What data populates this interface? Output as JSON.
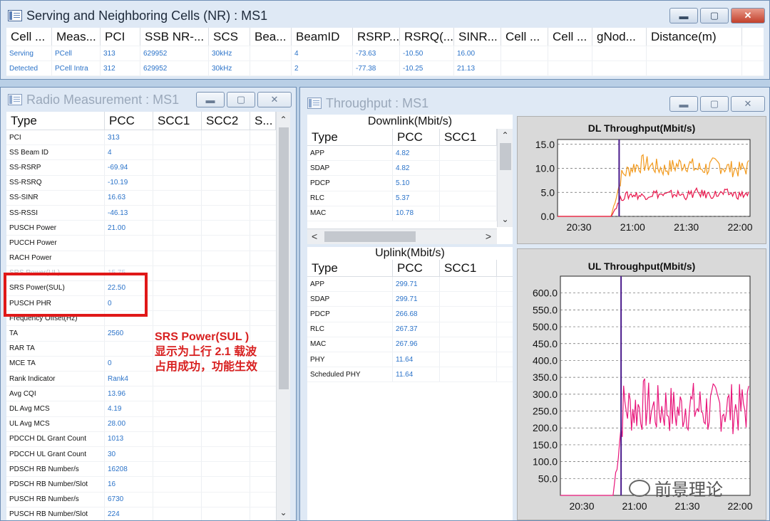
{
  "nr_window": {
    "title": "Serving and Neighboring Cells (NR) : MS1",
    "columns": [
      "Cell ...",
      "Meas...",
      "PCI",
      "SSB NR-...",
      "SCS",
      "Bea...",
      "BeamID",
      "RSRP...",
      "RSRQ(...",
      "SINR...",
      "Cell ...",
      "Cell ...",
      "gNod...",
      "Distance(m)"
    ],
    "rows": [
      [
        "Serving",
        "PCell",
        "313",
        "629952",
        "30kHz",
        "",
        "4",
        "-73.63",
        "-10.50",
        "16.00",
        "",
        "",
        "",
        ""
      ],
      [
        "Detected",
        "PCell Intra",
        "312",
        "629952",
        "30kHz",
        "",
        "2",
        "-77.38",
        "-10.25",
        "21.13",
        "",
        "",
        "",
        ""
      ]
    ]
  },
  "radio_window": {
    "title": "Radio Measurement : MS1",
    "columns": [
      "Type",
      "PCC",
      "SCC1",
      "SCC2",
      "S..."
    ],
    "rows": [
      [
        "PCI",
        "313"
      ],
      [
        "SS Beam ID",
        "4"
      ],
      [
        "SS-RSRP",
        "-69.94"
      ],
      [
        "SS-RSRQ",
        "-10.19"
      ],
      [
        "SS-SINR",
        "16.63"
      ],
      [
        "SS-RSSI",
        "-46.13"
      ],
      [
        "PUSCH Power",
        "21.00"
      ],
      [
        "PUCCH Power",
        ""
      ],
      [
        "RACH Power",
        ""
      ],
      [
        "SRS Power(UL)",
        "15.75"
      ],
      [
        "SRS Power(SUL)",
        "22.50"
      ],
      [
        "PUSCH PHR",
        "0"
      ],
      [
        "Frequency Offset(Hz)",
        ""
      ],
      [
        "TA",
        "2560"
      ],
      [
        "RAR TA",
        ""
      ],
      [
        "MCE TA",
        "0"
      ],
      [
        "Rank Indicator",
        "Rank4"
      ],
      [
        "Avg CQI",
        "13.96"
      ],
      [
        "DL Avg MCS",
        "4.19"
      ],
      [
        "UL Avg MCS",
        "28.00"
      ],
      [
        "PDCCH DL Grant Count",
        "1013"
      ],
      [
        "PDCCH UL Grant Count",
        "30"
      ],
      [
        "PDSCH RB Number/s",
        "16208"
      ],
      [
        "PDSCH RB Number/Slot",
        "16"
      ],
      [
        "PUSCH RB Number/s",
        "6730"
      ],
      [
        "PUSCH RB Number/Slot",
        "224"
      ]
    ]
  },
  "annotation": {
    "line1": "SRS  Power(SUL )",
    "line2": "显示为上行 2.1 载波",
    "line3": "占用成功，功能生效"
  },
  "throughput_window": {
    "title": "Throughput : MS1",
    "downlink": {
      "header": "Downlink(Mbit/s)",
      "columns": [
        "Type",
        "PCC",
        "SCC1"
      ],
      "rows": [
        [
          "APP",
          "4.82"
        ],
        [
          "SDAP",
          "4.82"
        ],
        [
          "PDCP",
          "5.10"
        ],
        [
          "RLC",
          "5.37"
        ],
        [
          "MAC",
          "10.78"
        ]
      ]
    },
    "uplink": {
      "header": "Uplink(Mbit/s)",
      "columns": [
        "Type",
        "PCC",
        "SCC1"
      ],
      "rows": [
        [
          "APP",
          "299.71"
        ],
        [
          "SDAP",
          "299.71"
        ],
        [
          "PDCP",
          "266.68"
        ],
        [
          "RLC",
          "267.37"
        ],
        [
          "MAC",
          "267.96"
        ],
        [
          "PHY",
          "11.64"
        ],
        [
          "Scheduled PHY",
          "11.64"
        ]
      ]
    }
  },
  "watermark": "前景理论",
  "colors": {
    "accent_blue": "#2b73c9",
    "annotation_red": "#e01818",
    "dl_series": "#f29a1e",
    "ul_series": "#e8157a",
    "cursor": "#4b1b8c"
  },
  "chart_data": [
    {
      "type": "line",
      "title": "DL Throughput(Mbit/s)",
      "xlabel": "",
      "ylabel": "",
      "x_ticks": [
        "20:30",
        "21:00",
        "21:30",
        "22:00"
      ],
      "y_ticks": [
        "0.0",
        "5.0",
        "10.0",
        "15.0"
      ],
      "ylim": [
        0,
        16
      ],
      "grid": true,
      "series": [
        {
          "values": [
            0,
            0,
            0,
            0,
            0,
            0,
            8.5,
            10.2,
            11.0,
            10.4,
            9.8,
            10.5,
            11.2,
            9.9,
            10.1,
            10.8,
            10.0,
            9.7,
            10.3
          ]
        },
        {
          "values": [
            0,
            0,
            0,
            0,
            0,
            0,
            4.0,
            4.6,
            4.2,
            4.8,
            4.4,
            4.7,
            4.3,
            4.9,
            4.5,
            4.6,
            4.8,
            4.4,
            4.7
          ]
        }
      ]
    },
    {
      "type": "line",
      "title": "UL Throughput(Mbit/s)",
      "xlabel": "",
      "ylabel": "",
      "x_ticks": [
        "20:30",
        "21:00",
        "21:30",
        "22:00"
      ],
      "y_ticks": [
        "50.0",
        "100.0",
        "150.0",
        "200.0",
        "250.0",
        "300.0",
        "350.0",
        "400.0",
        "450.0",
        "500.0",
        "550.0",
        "600.0"
      ],
      "ylim": [
        0,
        650
      ],
      "grid": true,
      "series": [
        {
          "values": [
            0,
            0,
            0,
            0,
            0,
            0,
            265,
            255,
            270,
            250,
            262,
            245,
            268,
            258,
            250,
            266,
            260,
            255,
            263
          ]
        }
      ]
    }
  ]
}
